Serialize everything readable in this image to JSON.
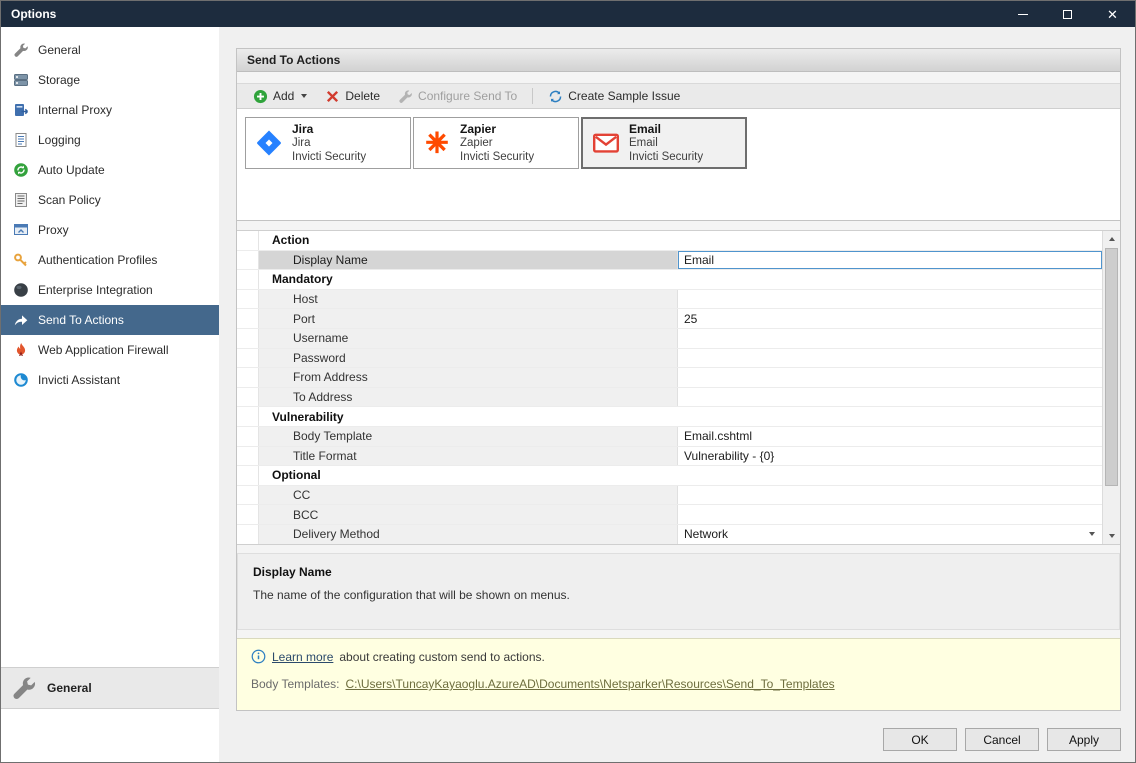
{
  "window": {
    "title": "Options"
  },
  "sidebar": {
    "items": [
      {
        "label": "General",
        "icon": "wrench-icon"
      },
      {
        "label": "Storage",
        "icon": "storage-icon"
      },
      {
        "label": "Internal Proxy",
        "icon": "internal-proxy-icon"
      },
      {
        "label": "Logging",
        "icon": "logging-icon"
      },
      {
        "label": "Auto Update",
        "icon": "auto-update-icon"
      },
      {
        "label": "Scan Policy",
        "icon": "scan-policy-icon"
      },
      {
        "label": "Proxy",
        "icon": "proxy-icon"
      },
      {
        "label": "Authentication Profiles",
        "icon": "key-icon"
      },
      {
        "label": "Enterprise Integration",
        "icon": "enterprise-icon"
      },
      {
        "label": "Send To Actions",
        "icon": "send-to-icon",
        "selected": true
      },
      {
        "label": "Web Application Firewall",
        "icon": "waf-icon"
      },
      {
        "label": "Invicti Assistant",
        "icon": "assistant-icon"
      }
    ],
    "footer": {
      "label": "General",
      "icon": "wrench-icon"
    }
  },
  "main": {
    "header": "Send To Actions",
    "toolbar": {
      "add": "Add",
      "delete": "Delete",
      "configure": "Configure Send To",
      "create_sample": "Create Sample Issue"
    },
    "cards": [
      {
        "title": "Jira",
        "line2": "Jira",
        "line3": "Invicti Security",
        "logo": "jira-logo"
      },
      {
        "title": "Zapier",
        "line2": "Zapier",
        "line3": "Invicti Security",
        "logo": "zapier-logo"
      },
      {
        "title": "Email",
        "line2": "Email",
        "line3": "Invicti Security",
        "logo": "email-logo",
        "selected": true
      }
    ],
    "property_grid": [
      {
        "type": "category",
        "label": "Action"
      },
      {
        "type": "row",
        "label": "Display Name",
        "value": "Email",
        "selected": true
      },
      {
        "type": "category",
        "label": "Mandatory"
      },
      {
        "type": "row",
        "label": "Host",
        "value": ""
      },
      {
        "type": "row",
        "label": "Port",
        "value": "25"
      },
      {
        "type": "row",
        "label": "Username",
        "value": ""
      },
      {
        "type": "row",
        "label": "Password",
        "value": ""
      },
      {
        "type": "row",
        "label": "From Address",
        "value": ""
      },
      {
        "type": "row",
        "label": "To Address",
        "value": ""
      },
      {
        "type": "category",
        "label": "Vulnerability"
      },
      {
        "type": "row",
        "label": "Body Template",
        "value": "Email.cshtml"
      },
      {
        "type": "row",
        "label": "Title Format",
        "value": "Vulnerability - {0}"
      },
      {
        "type": "category",
        "label": "Optional"
      },
      {
        "type": "row",
        "label": "CC",
        "value": ""
      },
      {
        "type": "row",
        "label": "BCC",
        "value": ""
      },
      {
        "type": "row",
        "label": "Delivery Method",
        "value": "Network",
        "dropdown": true
      }
    ],
    "description": {
      "title": "Display Name",
      "text": "The name of the configuration that will be shown on menus."
    },
    "info": {
      "learn_more": "Learn more",
      "learn_more_rest": "about creating custom send to actions.",
      "body_templates_label": "Body Templates:",
      "body_templates_path": "C:\\Users\\TuncayKayaoglu.AzureAD\\Documents\\Netsparker\\Resources\\Send_To_Templates"
    }
  },
  "footer_buttons": {
    "ok": "OK",
    "cancel": "Cancel",
    "apply": "Apply"
  },
  "colors": {
    "titlebar": "#1d2c3e",
    "sidebar_selected": "#44688c",
    "add_green": "#2fa33b",
    "delete_red": "#d23b2e",
    "info_bg": "#ffffe1",
    "focus_blue": "#4f94cd",
    "zapier_orange": "#ff4a00",
    "jira_blue": "#2681ff",
    "email_red": "#e34235"
  }
}
